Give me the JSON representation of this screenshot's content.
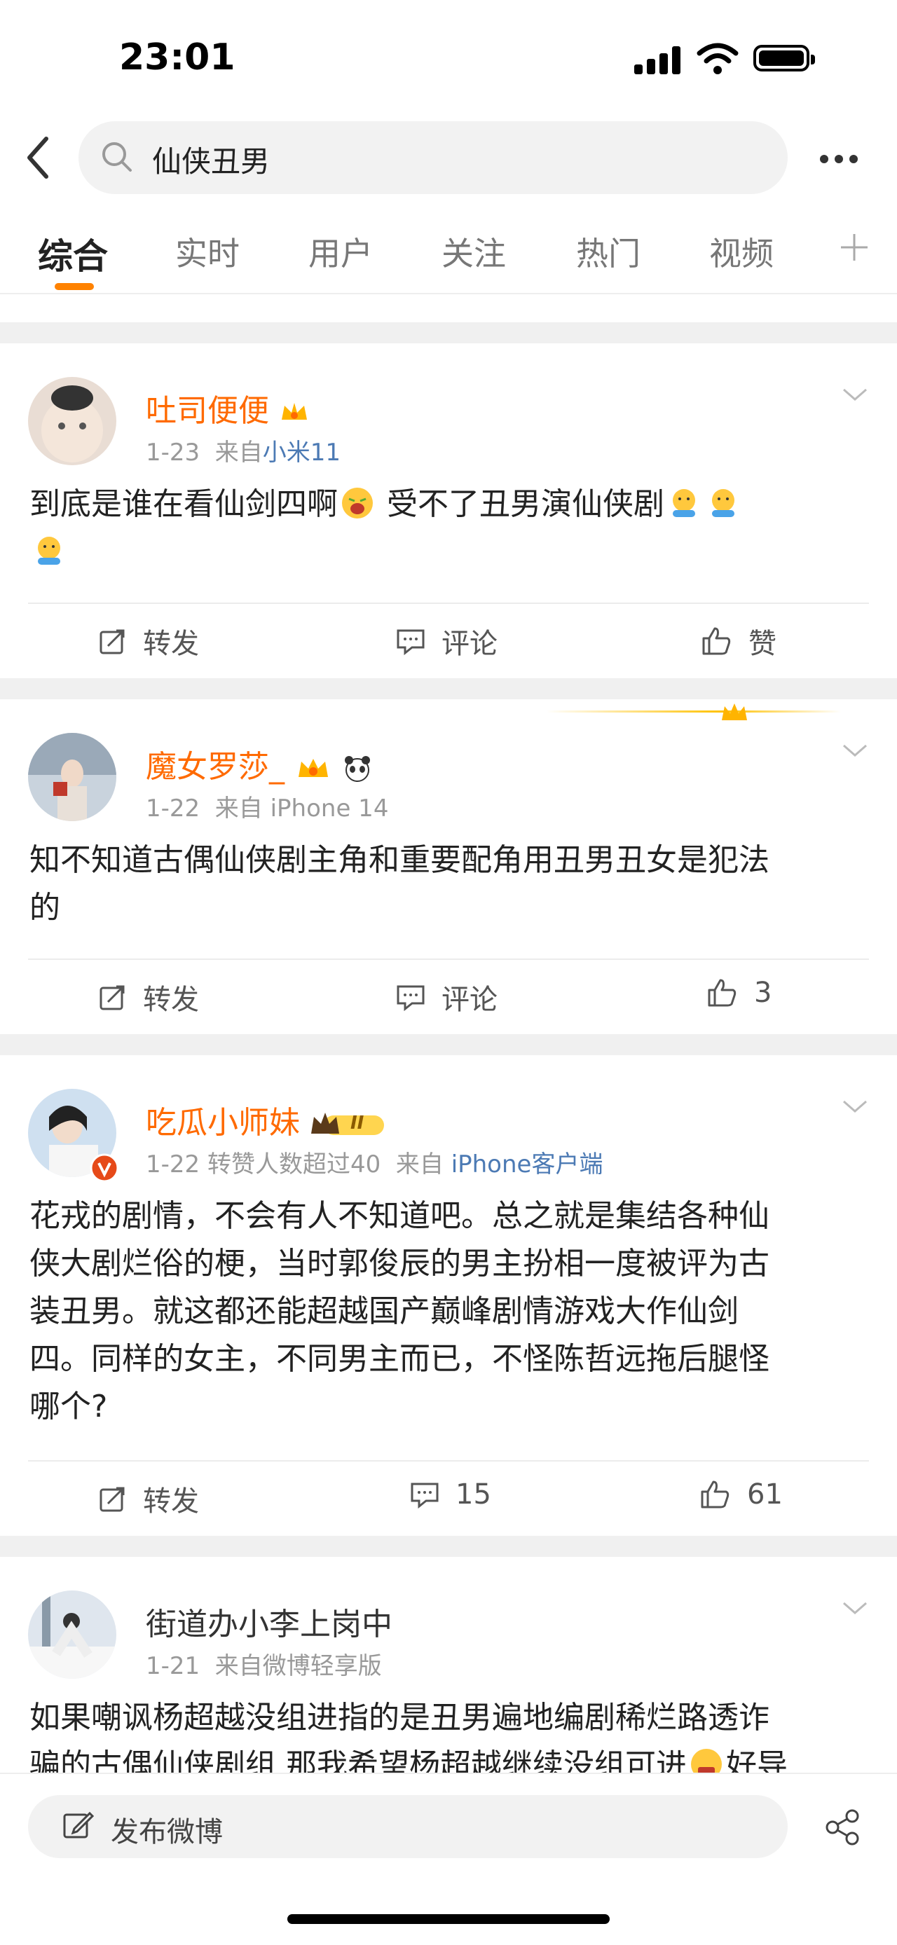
{
  "status_bar": {
    "time": "23:01"
  },
  "search": {
    "query": "仙侠丑男"
  },
  "tabs": [
    {
      "label": "综合",
      "active": true
    },
    {
      "label": "实时",
      "active": false
    },
    {
      "label": "用户",
      "active": false
    },
    {
      "label": "关注",
      "active": false
    },
    {
      "label": "热门",
      "active": false
    },
    {
      "label": "视频",
      "active": false
    }
  ],
  "colors": {
    "accent": "#ff8200",
    "username": "#ff6a00",
    "source_link": "#4c7ab4"
  },
  "posts": [
    {
      "username": "吐司便便",
      "date": "1-23",
      "from_prefix": "来自",
      "source": "小米11",
      "text_a": "到底是谁在看仙剑四啊",
      "text_b": "受不了丑男演仙侠剧",
      "repost": "转发",
      "comment": "评论",
      "like": "赞"
    },
    {
      "username": "魔女罗莎_",
      "date": "1-22",
      "from_prefix": "来自",
      "source": "iPhone 14",
      "text_line1": "知不知道古偶仙侠剧主角和重要配角用丑男丑女是犯法",
      "text_line2": "的",
      "repost": "转发",
      "comment": "评论",
      "like": "3"
    },
    {
      "username": "吃瓜小师妹",
      "level_badge": "II",
      "date": "1-22",
      "forward_note": "转赞人数超过40",
      "from_prefix": "来自",
      "source": "iPhone客户端",
      "text_lines": [
        "花戎的剧情，不会有人不知道吧。总之就是集结各种仙",
        "侠大剧烂俗的梗，当时郭俊辰的男主扮相一度被评为古",
        "装丑男。就这都还能超越国产巅峰剧情游戏大作仙剑",
        "四。同样的女主，不同男主而已，不怪陈哲远拖后腿怪",
        "哪个?"
      ],
      "repost": "转发",
      "comment": "15",
      "like": "61"
    },
    {
      "username": "街道办小李上岗中",
      "date": "1-21",
      "from_prefix": "来自",
      "source": "微博轻享版",
      "text_line1": "如果嘲讽杨超越没组进指的是丑男遍地编剧稀烂路透诈",
      "text_line2": "骗的古偶仙侠剧组 那我希望杨超越继续没组可进",
      "text_line2_tail": "好导"
    }
  ],
  "bottom": {
    "compose_label": "发布微博"
  }
}
